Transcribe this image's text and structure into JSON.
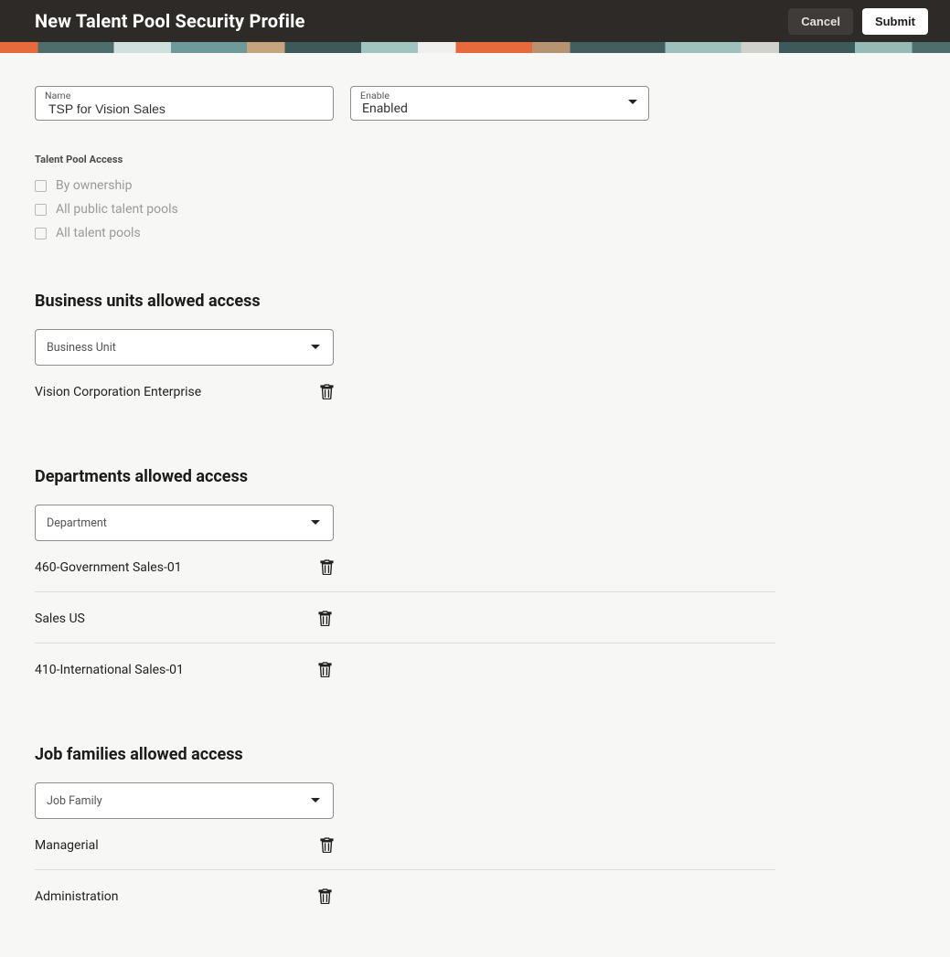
{
  "header": {
    "title": "New Talent Pool Security Profile",
    "cancel": "Cancel",
    "submit": "Submit"
  },
  "fields": {
    "name": {
      "label": "Name",
      "value": "TSP for Vision Sales"
    },
    "enable": {
      "label": "Enable",
      "value": "Enabled"
    }
  },
  "talent_pool_access": {
    "heading": "Talent Pool Access",
    "options": [
      {
        "label": "By ownership",
        "checked": false
      },
      {
        "label": "All public talent pools",
        "checked": false
      },
      {
        "label": "All talent pools",
        "checked": false
      }
    ]
  },
  "business_units": {
    "title": "Business units allowed access",
    "dropdown_placeholder": "Business Unit",
    "items": [
      "Vision Corporation Enterprise"
    ]
  },
  "departments": {
    "title": "Departments allowed access",
    "dropdown_placeholder": "Department",
    "items": [
      "460-Government Sales-01",
      "Sales US",
      "410-International Sales-01"
    ]
  },
  "job_families": {
    "title": "Job families allowed access",
    "dropdown_placeholder": "Job Family",
    "items": [
      "Managerial",
      "Administration"
    ]
  }
}
